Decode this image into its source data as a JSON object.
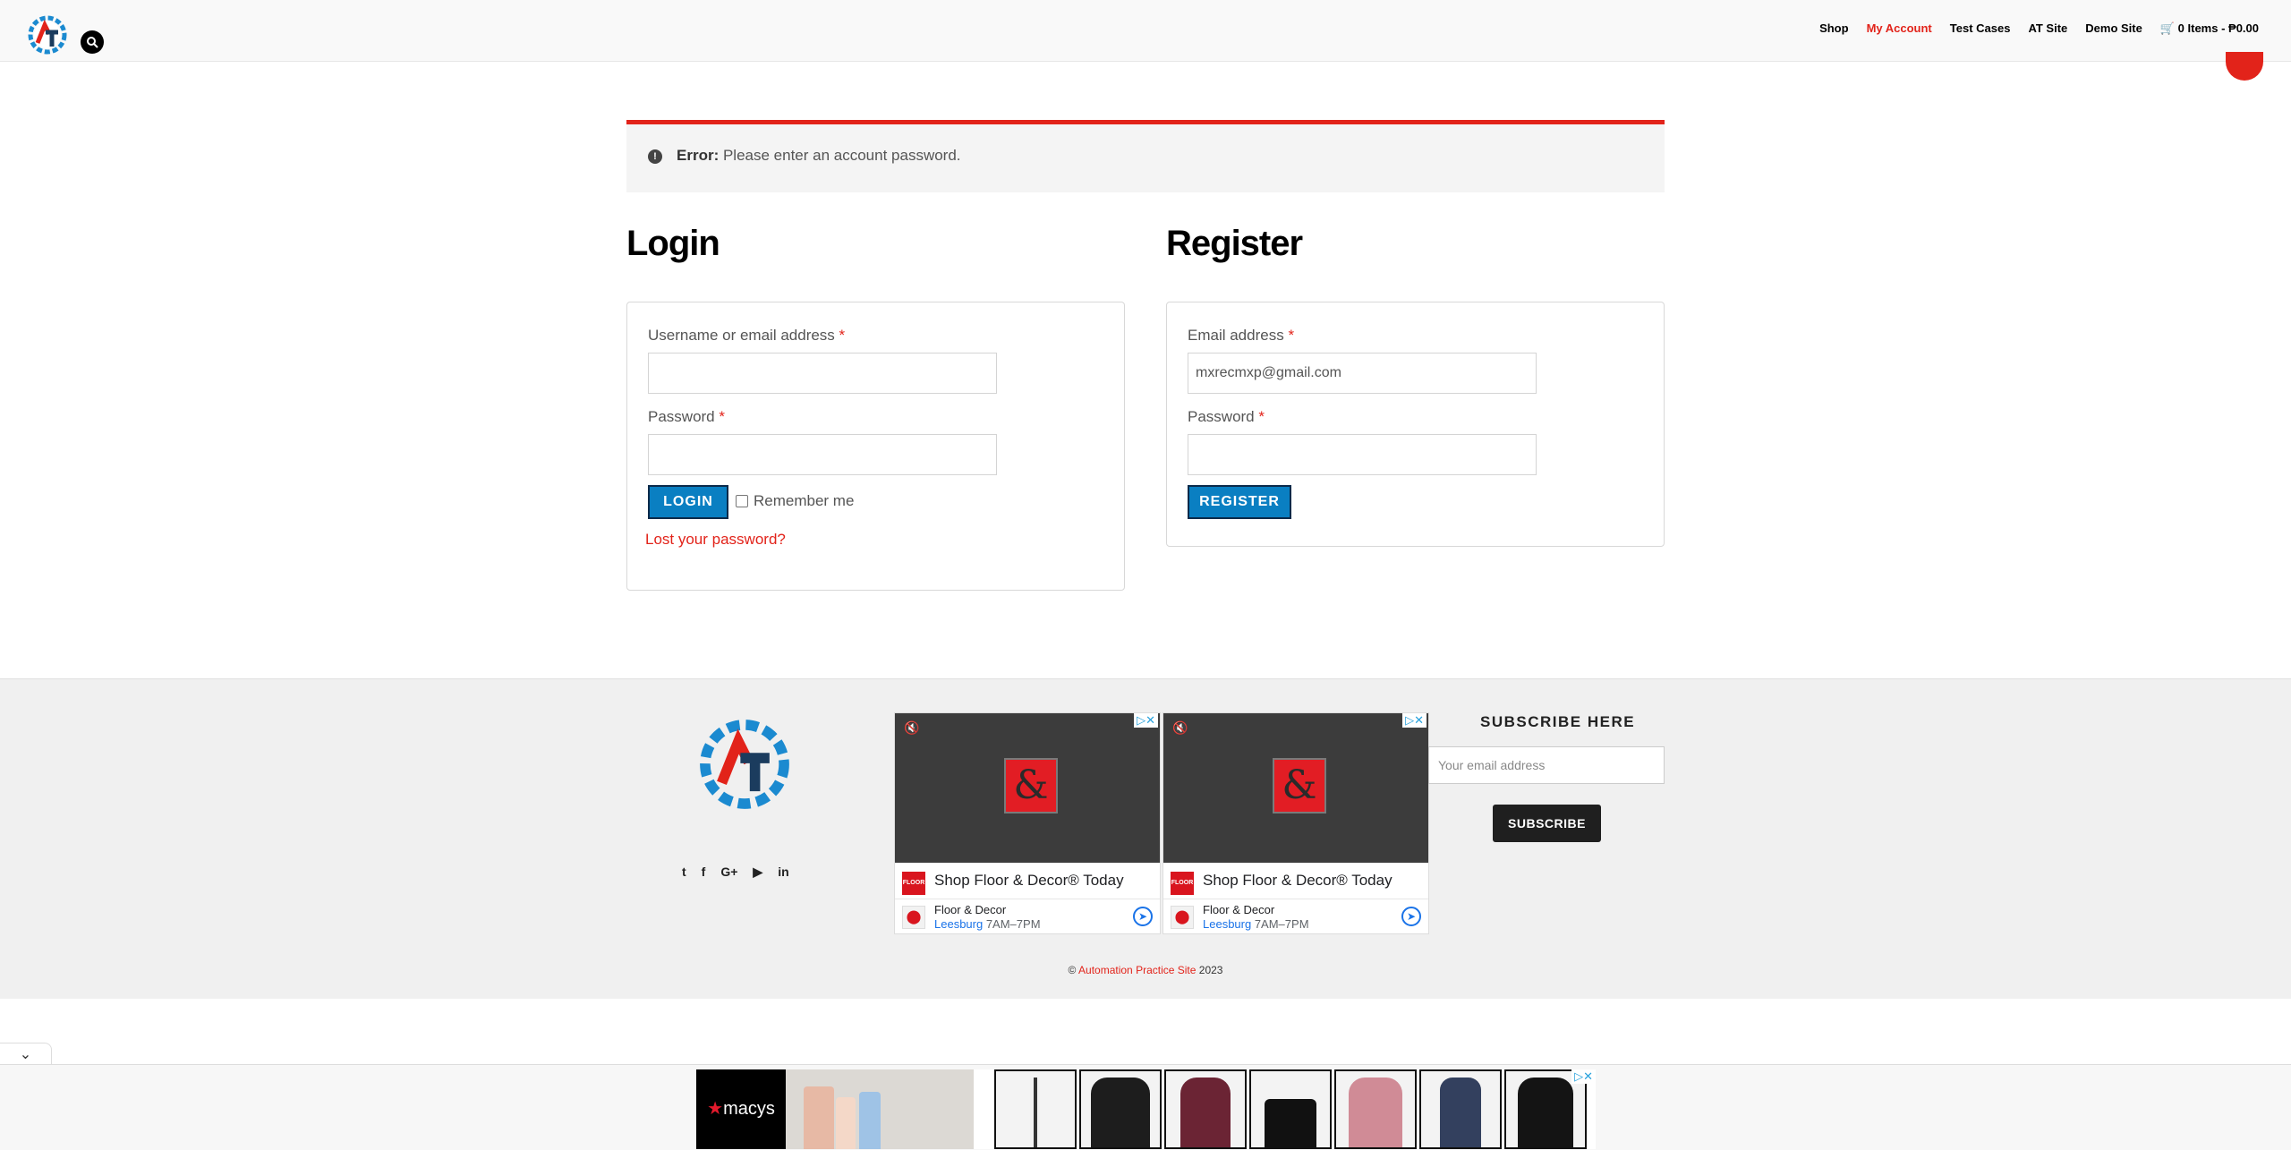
{
  "header": {
    "nav": [
      {
        "label": "Shop",
        "active": false
      },
      {
        "label": "My Account",
        "active": true
      },
      {
        "label": "Test Cases",
        "active": false
      },
      {
        "label": "AT Site",
        "active": false
      },
      {
        "label": "Demo Site",
        "active": false
      },
      {
        "label": "0 Items - ₱0.00",
        "active": false
      }
    ]
  },
  "error": {
    "prefix": "Error:",
    "message": " Please enter an account password."
  },
  "login": {
    "title": "Login",
    "username_label": "Username or email address",
    "username_value": "",
    "password_label": "Password",
    "password_value": "",
    "required_mark": "*",
    "button": "LOGIN",
    "remember": "Remember me",
    "lost_password": "Lost your password?"
  },
  "register": {
    "title": "Register",
    "email_label": "Email address",
    "email_value": "mxrecmxp@gmail.com",
    "password_label": "Password",
    "password_value": "",
    "required_mark": "*",
    "button": "REGISTER"
  },
  "footer": {
    "social_icons": [
      "twitter-icon",
      "facebook-icon",
      "google-plus-icon",
      "youtube-icon",
      "linkedin-icon"
    ],
    "social_glyphs": [
      "t",
      "f",
      "G+",
      "▶",
      "in"
    ],
    "ads": [
      {
        "title": "Shop Floor & Decor® Today",
        "business": "Floor & Decor",
        "city": "Leesburg",
        "hours": " 7AM–7PM",
        "brand_text": "FLOOR & DECOR"
      },
      {
        "title": "Shop Floor & Decor® Today",
        "business": "Floor & Decor",
        "city": "Leesburg",
        "hours": " 7AM–7PM",
        "brand_text": "FLOOR & DECOR"
      }
    ],
    "subscribe_title": "SUBSCRIBE HERE",
    "subscribe_placeholder": "Your email address",
    "subscribe_button": "SUBSCRIBE",
    "copyright_symbol": "©",
    "copyright_link": "Automation Practice Site",
    "copyright_year": "2023"
  },
  "bottom_ad": {
    "brand": "macys"
  },
  "colors": {
    "accent": "#e2231a",
    "button_blue": "#0a7fc2",
    "dark_button": "#1f1f1f"
  }
}
